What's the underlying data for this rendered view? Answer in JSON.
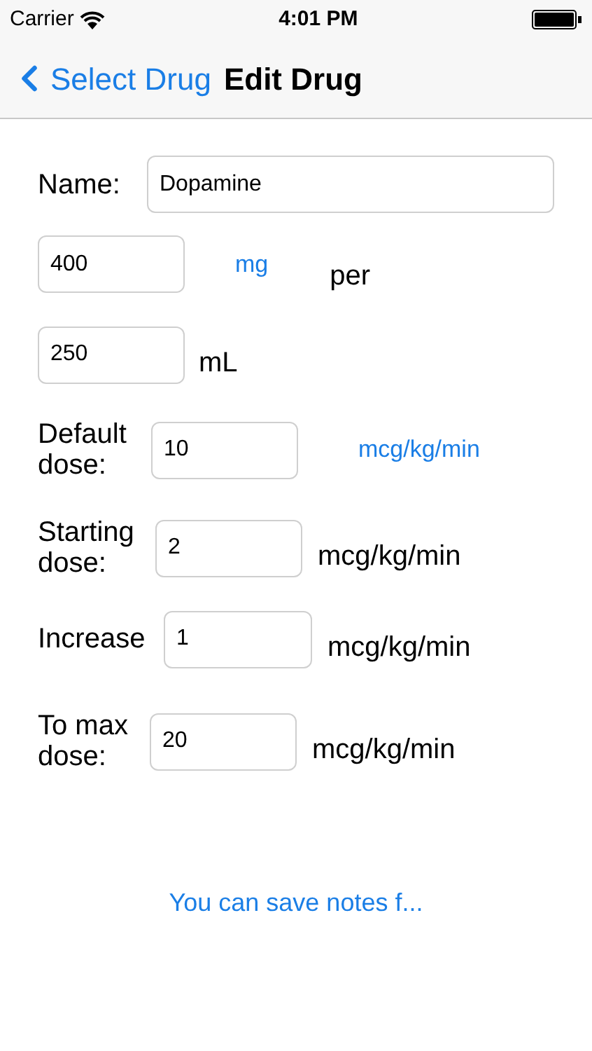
{
  "status_bar": {
    "carrier": "Carrier",
    "time": "4:01 PM"
  },
  "nav": {
    "back": "Select Drug",
    "title": "Edit Drug"
  },
  "name": {
    "label": "Name:",
    "value": "Dopamine"
  },
  "concentration": {
    "amount": "400",
    "unit": "mg",
    "per": "per",
    "volume": "250",
    "volume_unit": "mL"
  },
  "default_dose": {
    "label": "Default dose:",
    "value": "10",
    "unit": "mcg/kg/min"
  },
  "doses": [
    {
      "label": "Starting dose:",
      "value": "2",
      "unit": "mcg/kg/min"
    },
    {
      "label": "Increase",
      "value": "1",
      "unit": "mcg/kg/min"
    },
    {
      "label": "To max dose:",
      "value": "20",
      "unit": "mcg/kg/min"
    }
  ],
  "notes_link": "You can save notes f..."
}
